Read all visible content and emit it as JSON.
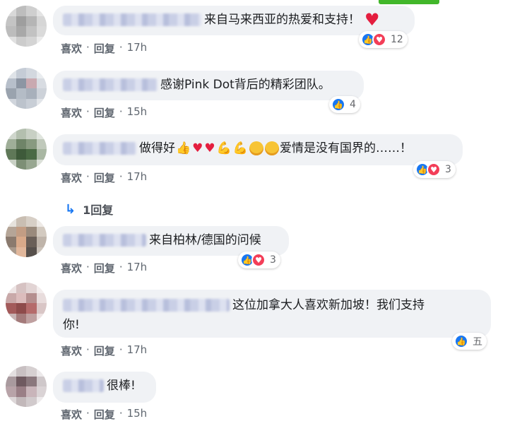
{
  "comments": [
    {
      "text": "来自马来西亚的热爱和支持！",
      "like_label": "喜欢",
      "reply_label": "回复",
      "time": "17h",
      "reaction_count": "12"
    },
    {
      "text": "感谢Pink Dot背后的精彩团队。",
      "like_label": "喜欢",
      "reply_label": "回复",
      "time": "15h",
      "reaction_count": "4"
    },
    {
      "text_before": "做得好",
      "text_after": "爱情是没有国界的……！",
      "like_label": "喜欢",
      "reply_label": "回复",
      "time": "17h",
      "reaction_count": "3"
    },
    {
      "text": "来自柏林/德国的问候",
      "like_label": "喜欢",
      "reply_label": "回复",
      "time": "17h",
      "reaction_count": "3"
    },
    {
      "text_line1": "这位加拿大人喜欢新加坡！我们支持",
      "text_line2": "你!",
      "like_label": "喜欢",
      "reply_label": "回复",
      "time": "17h",
      "reaction_count": "五"
    },
    {
      "text": "很棒!",
      "like_label": "喜欢",
      "reply_label": "回复",
      "time": "15h"
    }
  ],
  "reply_thread": {
    "label": "1回复"
  },
  "colors": {
    "bubble": "#f0f2f5",
    "like_blue": "#1877f2",
    "love_red": "#f33e58",
    "meta_gray": "#606770"
  },
  "icons": [
    "like-reaction-icon",
    "love-reaction-icon",
    "reply-arrow-icon",
    "thumbs-up-emoji",
    "heart-emoji",
    "flexed-biceps-emoji",
    "partying-face-emoji"
  ]
}
